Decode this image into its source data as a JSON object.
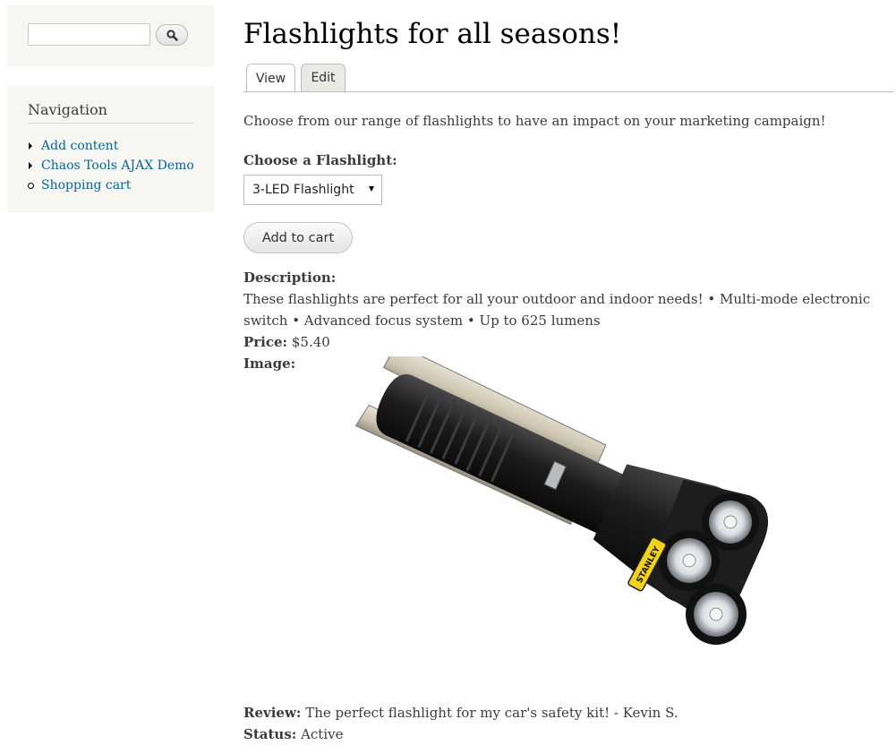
{
  "sidebar": {
    "search": {
      "value": "",
      "button_icon": "search-icon"
    },
    "navigation": {
      "title": "Navigation",
      "items": [
        {
          "label": "Add content",
          "bullet": "triangle"
        },
        {
          "label": "Chaos Tools AJAX Demo",
          "bullet": "triangle"
        },
        {
          "label": "Shopping cart",
          "bullet": "circle"
        }
      ]
    }
  },
  "main": {
    "title": "Flashlights for all seasons!",
    "tabs": [
      {
        "label": "View"
      },
      {
        "label": "Edit"
      }
    ],
    "intro": "Choose from our range of flashlights to have an impact on your marketing campaign!",
    "choose_label": "Choose a Flashlight:",
    "selected_option": "3-LED Flashlight",
    "add_to_cart": "Add to cart",
    "description_label": "Description:",
    "description": "These flashlights are perfect for all your outdoor and indoor needs! • Multi-mode electronic switch • Advanced focus system • Up to 625 lumens",
    "price_label": "Price:",
    "price": "$5.40",
    "image_label": "Image:",
    "image_brand": "STANLEY",
    "review_label": "Review:",
    "review": "The perfect flashlight for my car's safety kit! - Kevin S.",
    "status_label": "Status:",
    "status": "Active"
  },
  "colors": {
    "link": "#0a6592",
    "sidebar_bg": "#f6f6f2",
    "text": "#3b3b3b"
  }
}
